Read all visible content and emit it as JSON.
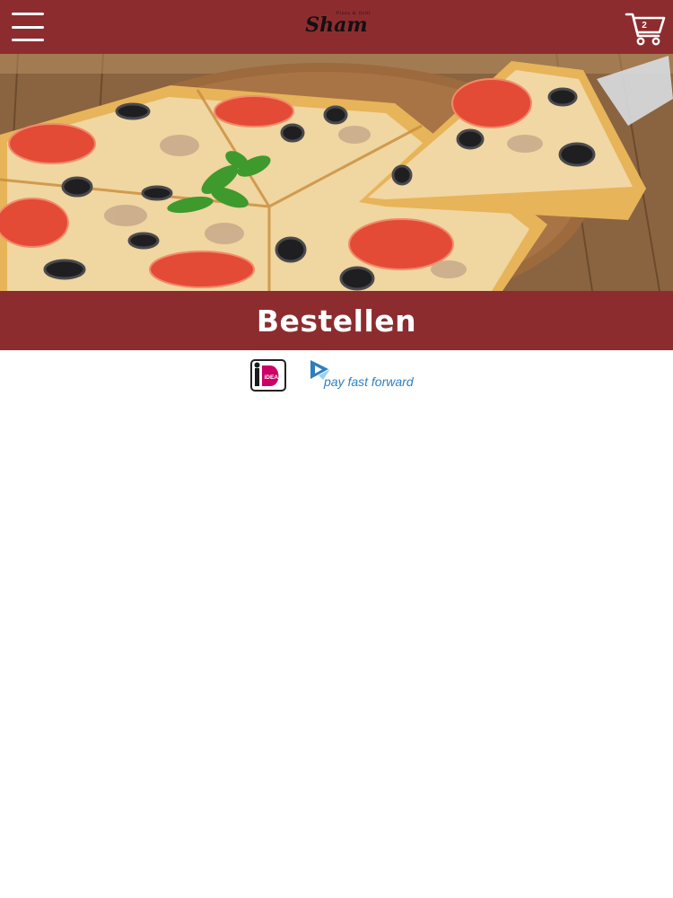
{
  "header": {
    "logo_small_text": "Pizza & Grill",
    "logo_main_text": "Sham",
    "cart_count": "2"
  },
  "banner": {
    "title": "Bestellen"
  },
  "payments": {
    "ideal_label": "iDEAL",
    "pff_label": "pay fast forward"
  },
  "colors": {
    "brand": "#8d2c2f",
    "pff_blue": "#2d7ec0",
    "ideal_pink": "#cc0066"
  },
  "icons": {
    "menu": "menu-icon",
    "cart": "cart-icon",
    "ideal": "ideal-logo-icon",
    "pff": "pay-fast-forward-icon"
  }
}
